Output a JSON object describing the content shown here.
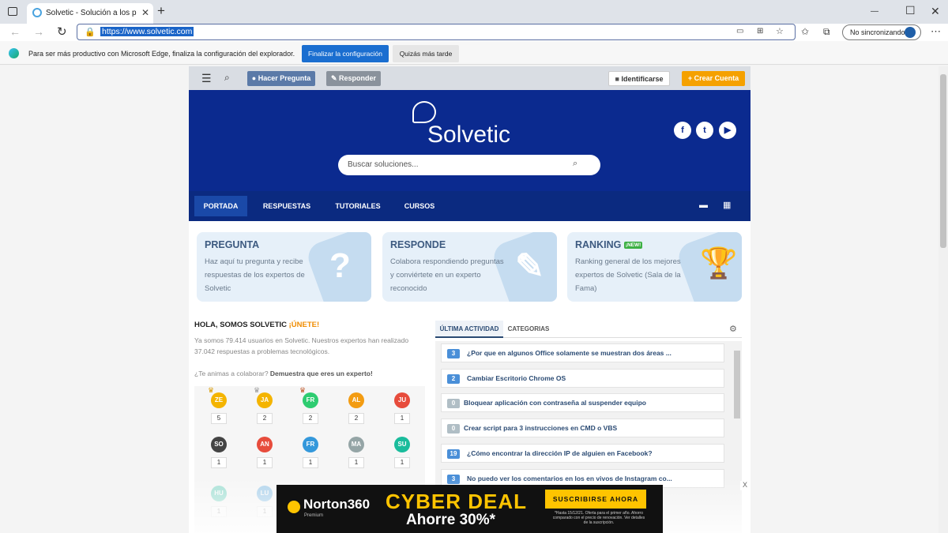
{
  "browser": {
    "tab_title": "Solvetic - Solución a los problem",
    "tab_close": "✕",
    "new_tab": "+",
    "url": "https://www.solvetic.com",
    "sync_label": "No sincronizando",
    "infobar_message": "Para ser más productivo con Microsoft Edge, finaliza la configuración del explorador.",
    "finish_button": "Finalizar la configuración",
    "later_button": "Quizás más tarde",
    "minimize": "—",
    "maximize": "☐",
    "close": "✕"
  },
  "site": {
    "topnav": {
      "ask_button": "Hacer Pregunta",
      "answer_button": "Responder",
      "login_button": "Identificarse",
      "create_account_button": "Crear Cuenta"
    },
    "logo_text": "Solvetic",
    "search_placeholder": "Buscar soluciones...",
    "social": [
      "f",
      "t",
      "▶"
    ],
    "menu": [
      "PORTADA",
      "RESPUESTAS",
      "TUTORIALES",
      "CURSOS"
    ],
    "cards": [
      {
        "title": "PREGUNTA",
        "desc": "Haz aquí tu pregunta y recibe respuestas de los expertos de Solvetic",
        "icon": "?"
      },
      {
        "title": "RESPONDE",
        "desc": "Colabora respondiendo preguntas y conviértete en un experto reconocido",
        "icon": "✎"
      },
      {
        "title": "RANKING",
        "badge": "¡NEW!",
        "desc": "Ranking general de los mejores expertos de Solvetic (Sala de la Fama)",
        "icon": "🏆"
      }
    ],
    "hola_title": "HOLA, SOMOS SOLVETIC",
    "hola_join": "¡ÚNETE!",
    "hola_text": "Ya somos 79.414 usuarios en Solvetic. Nuestros expertos han realizado 37.042 respuestas a problemas tecnológicos.",
    "hola_invite": "¿Te animas a colaborar?",
    "hola_invite_bold": "Demuestra que eres un experto!",
    "users": [
      {
        "initials": "ZE",
        "count": "5",
        "color": "#f4b400"
      },
      {
        "initials": "JA",
        "count": "2",
        "color": "#f4b400"
      },
      {
        "initials": "FR",
        "count": "2",
        "color": "#2ecc71"
      },
      {
        "initials": "AL",
        "count": "2",
        "color": "#f39c12"
      },
      {
        "initials": "JU",
        "count": "1",
        "color": "#e74c3c"
      },
      {
        "initials": "SO",
        "count": "1",
        "color": "#444444"
      },
      {
        "initials": "AN",
        "count": "1",
        "color": "#e74c3c"
      },
      {
        "initials": "FR",
        "count": "1",
        "color": "#3498db"
      },
      {
        "initials": "MA",
        "count": "1",
        "color": "#95a5a6"
      },
      {
        "initials": "SU",
        "count": "1",
        "color": "#1abc9c"
      },
      {
        "initials": "HU",
        "count": "1",
        "color": "#1abc9c"
      },
      {
        "initials": "LU",
        "count": "1",
        "color": "#3498db"
      }
    ],
    "activity_tabs": [
      "ÚLTIMA ACTIVIDAD",
      "CATEGORIAS"
    ],
    "activity": [
      {
        "num": "3",
        "title": "¿Por que en algunos Office solamente se muestran dos áreas ...",
        "color": "#4a8fd8"
      },
      {
        "num": "2",
        "title": "Cambiar Escritorio Chrome OS",
        "color": "#4a8fd8"
      },
      {
        "num": "0",
        "title": "Bloquear aplicación con contraseña al suspender equipo",
        "color": "#b0bec5"
      },
      {
        "num": "0",
        "title": "Crear script para 3 instrucciones en CMD o VBS",
        "color": "#b0bec5"
      },
      {
        "num": "19",
        "title": "¿Cómo encontrar la dirección IP de alguien en Facebook?",
        "color": "#4a8fd8"
      },
      {
        "num": "3",
        "title": "No puedo ver los comentarios en los en vivos de Instagram co...",
        "color": "#4a8fd8"
      }
    ]
  },
  "ad": {
    "brand": "Norton360",
    "sub": "Premium",
    "headline": "CYBER DEAL",
    "offer": "Ahorre 30%*",
    "cta": "SUSCRIBIRSE AHORA",
    "fine": "*Hasta 15/12/21. Oferta para el primer año. Ahorro comparado con el precio de renovación. Ver detalles de la suscripción.",
    "close": "X"
  }
}
